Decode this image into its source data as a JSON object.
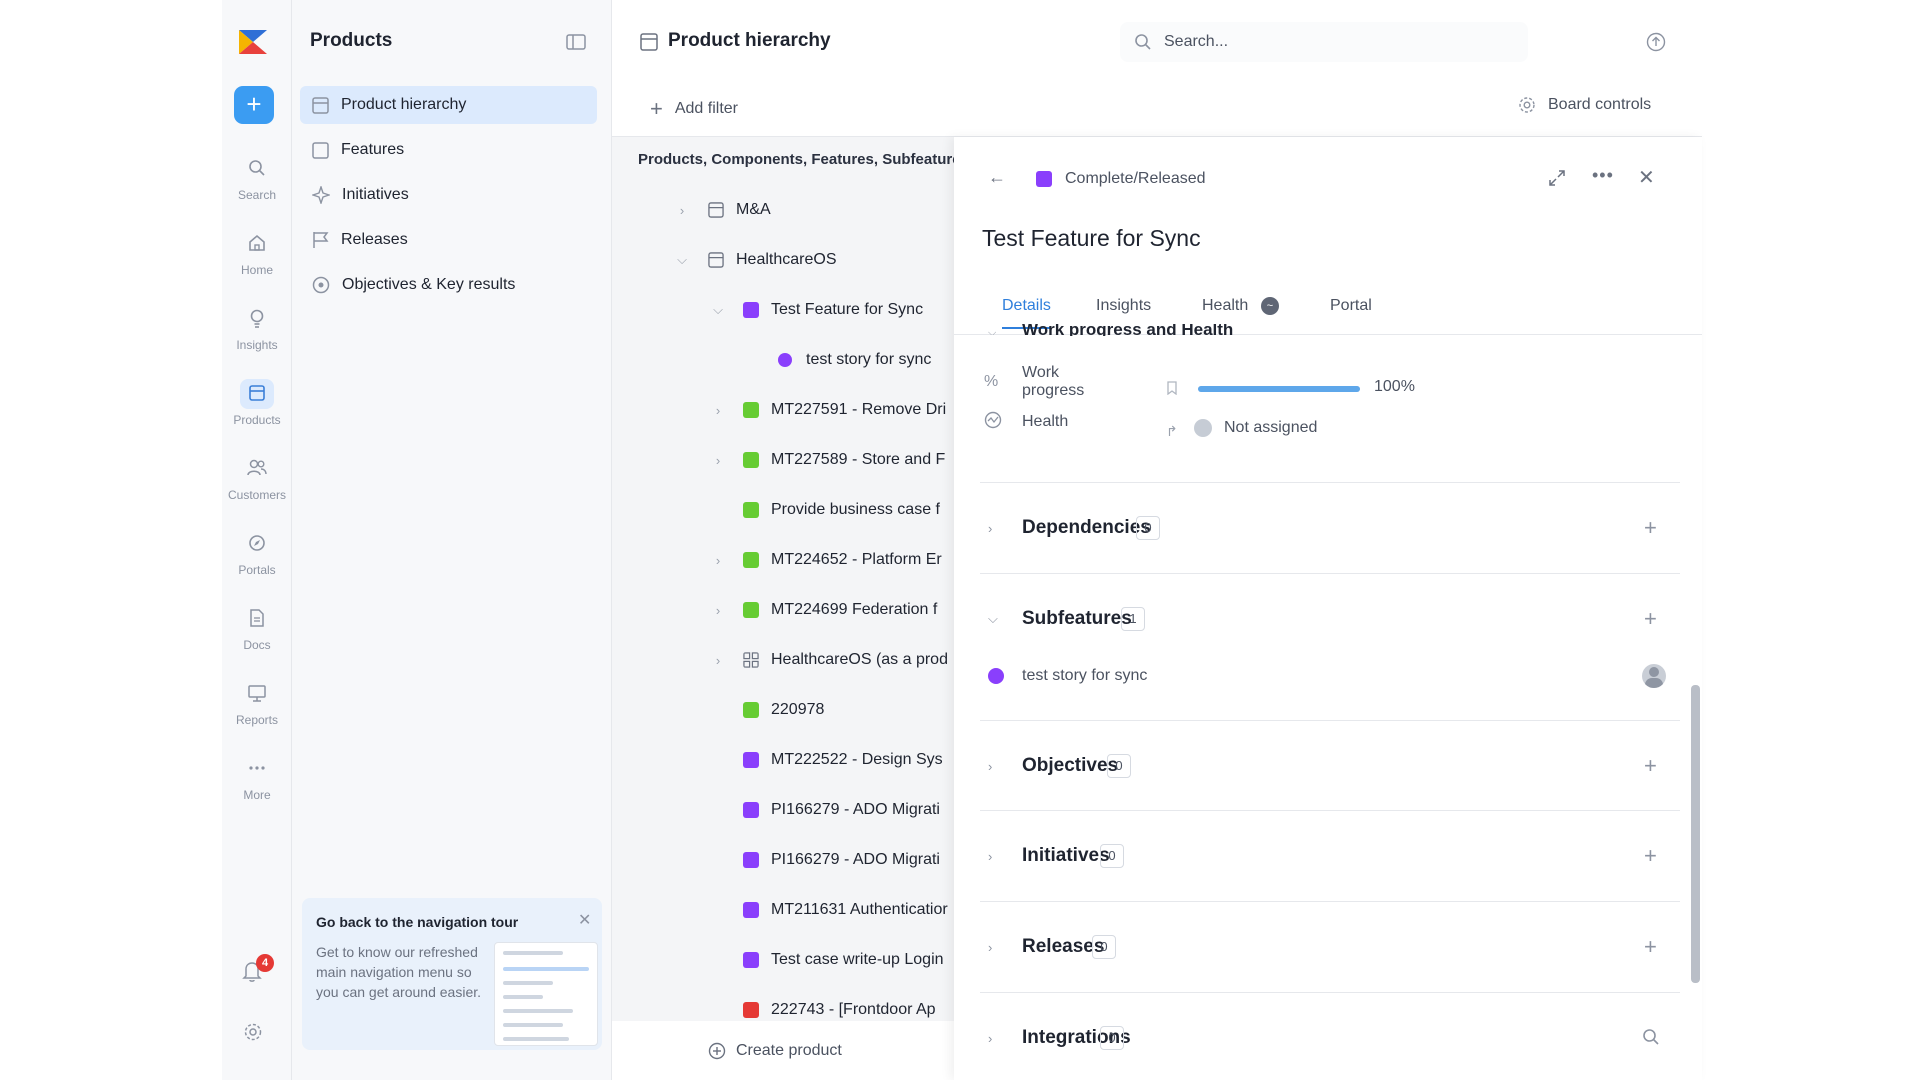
{
  "colors": {
    "accent": "#3b9cf2",
    "purple": "#8a3ffc",
    "green": "#66cc33",
    "red": "#e53935",
    "grey_icon": "#8c93a1"
  },
  "rail": {
    "new_icon": "plus-icon",
    "items": [
      {
        "label": "Search",
        "icon": "search-icon"
      },
      {
        "label": "Home",
        "icon": "home-icon"
      },
      {
        "label": "Insights",
        "icon": "lightbulb-icon"
      },
      {
        "label": "Products",
        "icon": "products-icon",
        "active": true
      },
      {
        "label": "Customers",
        "icon": "customers-icon"
      },
      {
        "label": "Portals",
        "icon": "compass-icon"
      },
      {
        "label": "Docs",
        "icon": "docs-icon"
      },
      {
        "label": "Reports",
        "icon": "reports-icon"
      },
      {
        "label": "More",
        "icon": "more-icon"
      }
    ],
    "notification_count": "4"
  },
  "sidebar": {
    "title": "Products",
    "items": [
      {
        "label": "Product hierarchy",
        "active": true
      },
      {
        "label": "Features"
      },
      {
        "label": "Initiatives"
      },
      {
        "label": "Releases"
      },
      {
        "label": "Objectives & Key results"
      }
    ],
    "tour": {
      "title": "Go back to the navigation tour",
      "body": "Get to know our refreshed main navigation menu so you can get around easier."
    }
  },
  "main": {
    "title": "Product hierarchy",
    "search_placeholder": "Search...",
    "add_filter": "Add filter",
    "board_controls": "Board controls"
  },
  "tree": {
    "header": "Products, Components, Features, Subfeatures",
    "rows": [
      {
        "label": "M&A",
        "kind": "component",
        "chevron": "right",
        "level": 1
      },
      {
        "label": "HealthcareOS",
        "kind": "component",
        "chevron": "down",
        "level": 1
      },
      {
        "label": "Test Feature for Sync",
        "kind": "feature",
        "color": "#8a3ffc",
        "chevron": "down",
        "level": 2
      },
      {
        "label": "test story for sync",
        "kind": "subfeature",
        "color": "#8a3ffc",
        "level": 3
      },
      {
        "label": "MT227591 - Remove Dri",
        "kind": "feature",
        "color": "#66cc33",
        "chevron": "right",
        "level": 2
      },
      {
        "label": "MT227589 - Store and F",
        "kind": "feature",
        "color": "#66cc33",
        "chevron": "right",
        "level": 2
      },
      {
        "label": "Provide business case f",
        "kind": "feature",
        "color": "#66cc33",
        "level": 2
      },
      {
        "label": "MT224652 - Platform Er",
        "kind": "feature",
        "color": "#66cc33",
        "chevron": "right",
        "level": 2
      },
      {
        "label": "MT224699 Federation f",
        "kind": "feature",
        "color": "#66cc33",
        "chevron": "right",
        "level": 2
      },
      {
        "label": "HealthcareOS (as a prod",
        "kind": "grid",
        "chevron": "right",
        "level": 2
      },
      {
        "label": "220978",
        "kind": "feature",
        "color": "#66cc33",
        "level": 2
      },
      {
        "label": "MT222522 - Design Sys",
        "kind": "feature",
        "color": "#8a3ffc",
        "level": 2
      },
      {
        "label": "PI166279 - ADO Migrati",
        "kind": "feature",
        "color": "#8a3ffc",
        "level": 2
      },
      {
        "label": "PI166279 - ADO Migrati",
        "kind": "feature",
        "color": "#8a3ffc",
        "level": 2
      },
      {
        "label": "MT211631 Authenticatior",
        "kind": "feature",
        "color": "#8a3ffc",
        "level": 2
      },
      {
        "label": "Test case write-up Login",
        "kind": "feature",
        "color": "#8a3ffc",
        "level": 2
      },
      {
        "label": "222743 - [Frontdoor Ap",
        "kind": "feature",
        "color": "#e53935",
        "level": 2
      }
    ],
    "create_product": "Create product"
  },
  "detail": {
    "status": "Complete/Released",
    "status_color": "#8a3ffc",
    "title": "Test Feature for Sync",
    "tabs": [
      "Details",
      "Insights",
      "Health",
      "Portal"
    ],
    "active_tab": "Details",
    "section_cut": "Work progress and Health",
    "work_progress_label": "Work progress",
    "work_progress_value": "100%",
    "work_progress_fraction": 1.0,
    "health_label": "Health",
    "health_value": "Not assigned",
    "sections": [
      {
        "title": "Dependencies",
        "count": "0",
        "expanded": false
      },
      {
        "title": "Subfeatures",
        "count": "1",
        "expanded": true
      },
      {
        "title": "Objectives",
        "count": "0",
        "expanded": false
      },
      {
        "title": "Initiatives",
        "count": "0",
        "expanded": false
      },
      {
        "title": "Releases",
        "count": "0",
        "expanded": false
      },
      {
        "title": "Integrations",
        "count": "0",
        "expanded": false
      }
    ],
    "subfeature": {
      "label": "test story for sync",
      "color": "#8a3ffc"
    }
  }
}
